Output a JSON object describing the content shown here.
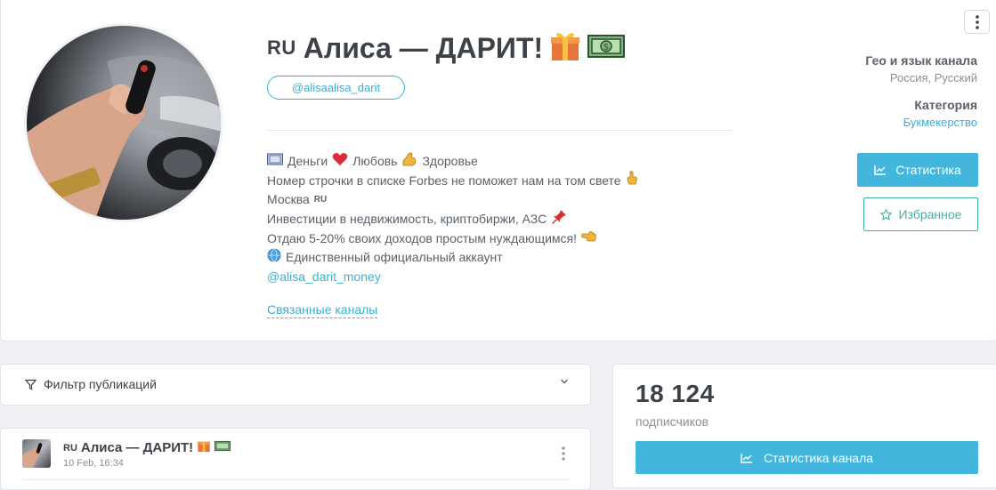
{
  "channel": {
    "flag_code": "RU",
    "title": "Алиса — ДАРИТ!",
    "handle": "@alisaalisa_darit",
    "title_emojis": [
      "gift-emoji",
      "money-emoji"
    ]
  },
  "description": {
    "line1": {
      "money": "Деньги",
      "love": "Любовь",
      "health": "Здоровье"
    },
    "line2": "Номер строчки в списке Forbes не поможет нам на том свете",
    "line3_text": "Москва",
    "line3_flag": "RU",
    "line4": "Инвестиции в недвижимость, криптобиржи, АЗС",
    "line5": "Отдаю 5-20% своих доходов простым нуждающимся!",
    "line6": "Единственный официальный аккаунт",
    "link": "@alisa_darit_money"
  },
  "related_channels": "Связанные каналы",
  "meta": {
    "geo_label": "Гео и язык канала",
    "geo_value": "Россия, Русский",
    "category_label": "Категория",
    "category_value": "Букмекерство"
  },
  "buttons": {
    "statistics": "Статистика",
    "favorites": "Избранное",
    "channel_statistics": "Статистика канала"
  },
  "filter": {
    "label": "Фильтр публикаций"
  },
  "post": {
    "flag_code": "RU",
    "title": "Алиса — ДАРИТ!",
    "date": "10 Feb, 16:34"
  },
  "stats": {
    "subscribers_count": "18 124",
    "subscribers_label": "подписчиков"
  },
  "colors": {
    "accent": "#42b6dc",
    "favorite": "#3fb3a0",
    "text_dark": "#3d4249",
    "text_muted": "#8a9097"
  }
}
